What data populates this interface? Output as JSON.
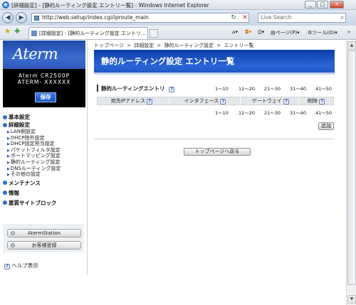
{
  "window": {
    "title": "[詳細設定] - [静的ルーティング設定 エントリ一覧] - Windows Internet Explorer",
    "minimize": "_",
    "maximize": "□",
    "close": "X"
  },
  "nav": {
    "url": "http://web.setup/index.cgi/iproute_main",
    "search_placeholder": "Live Search"
  },
  "tabbar": {
    "tab_label": "[詳細設定] - [静的ルーティング設定 エントリ...",
    "page_menu": "ページ(P)",
    "tools_menu": "ツール(O)"
  },
  "sidebar": {
    "logo": "Aterm",
    "model": "Aterm CR2500P",
    "serial": "ATERM- XXXXXX",
    "save_label": "保存",
    "menu": [
      {
        "label": "基本設定",
        "items": []
      },
      {
        "label": "詳細設定",
        "items": [
          "LAN側設定",
          "DHCP除外設定",
          "DHCP固定割当設定",
          "パケットフィルタ設定",
          "ポートマッピング設定",
          "静的ルーティング設定",
          "DNSルーティング設定",
          "その他の設定"
        ]
      },
      {
        "label": "メンテナンス",
        "items": []
      },
      {
        "label": "情報",
        "items": []
      },
      {
        "label": "悪質サイトブロック",
        "items": []
      }
    ],
    "btn_station": "AtermStation",
    "btn_register": "お客様登録",
    "help": "ヘルプ表示"
  },
  "main": {
    "breadcrumb": [
      "トップページ",
      ">",
      "詳細設定",
      ">",
      "静的ルーティング設定",
      ">",
      "エントリ一覧"
    ],
    "page_title": "静的ルーティング設定 エントリ一覧",
    "section_title": "静的ルーティングエントリ",
    "pages": [
      "1〜10",
      "11〜20",
      "21〜30",
      "31〜40",
      "41〜50"
    ],
    "columns": [
      "宛先IPアドレス",
      "インタフェース",
      "ゲートウェイ",
      "削除"
    ],
    "add_label": "追加",
    "top_label": "トップページへ戻る"
  }
}
